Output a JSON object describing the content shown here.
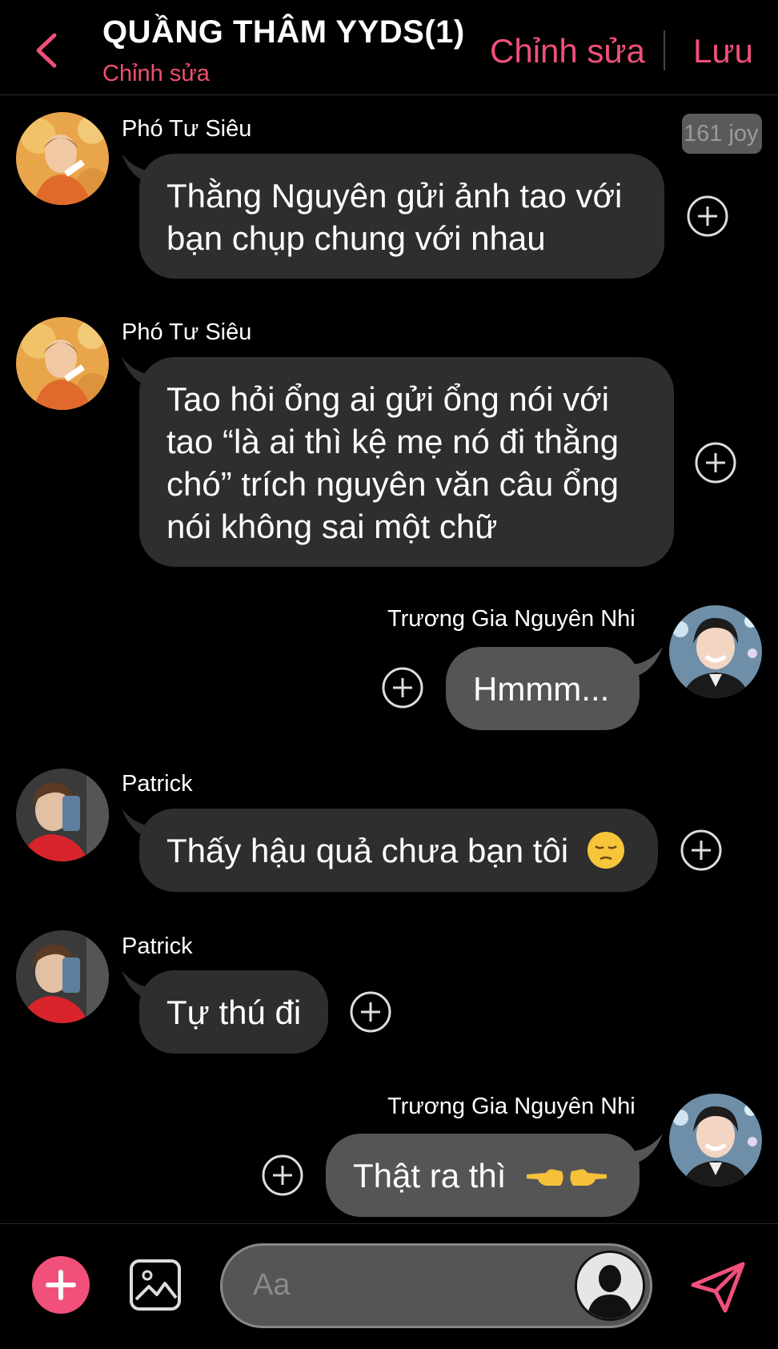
{
  "header": {
    "title": "QUẦNG THÂM YYDS(1)",
    "subtitle": "Chỉnh sửa",
    "edit_label": "Chỉnh sửa",
    "save_label": "Lưu"
  },
  "badge": "161 joy",
  "messages": [
    {
      "sender": "Phó Tư Siêu",
      "lines": [
        "Thằng Nguyên gửi ảnh tao với",
        "bạn chụp chung với nhau"
      ],
      "mine": false
    },
    {
      "sender": "Phó Tư Siêu",
      "lines": [
        "Tao hỏi ổng ai gửi ổng nói với",
        "tao “là ai thì kệ mẹ nó đi thằng",
        "chó” trích nguyên văn câu ổng",
        "nói không sai một chữ"
      ],
      "mine": false
    },
    {
      "sender": "Trương Gia Nguyên Nhi",
      "lines": [
        "Hmmm..."
      ],
      "mine": true
    },
    {
      "sender": "Patrick",
      "lines": [
        "Thấy hậu quả chưa bạn tôi"
      ],
      "emoji": "pensive-face-emoji",
      "mine": false
    },
    {
      "sender": "Patrick",
      "lines": [
        "Tự thú đi"
      ],
      "mine": false
    },
    {
      "sender": "Trương Gia Nguyên Nhi",
      "lines": [
        "Thật ra thì"
      ],
      "emoji": "pointing-fingers-emoji",
      "mine": true
    }
  ],
  "composer": {
    "placeholder": "Aa"
  },
  "colors": {
    "accent": "#f0507a",
    "subtitle": "#f0506e",
    "bubble_other": "#2e2e2e",
    "bubble_mine": "#555556"
  }
}
